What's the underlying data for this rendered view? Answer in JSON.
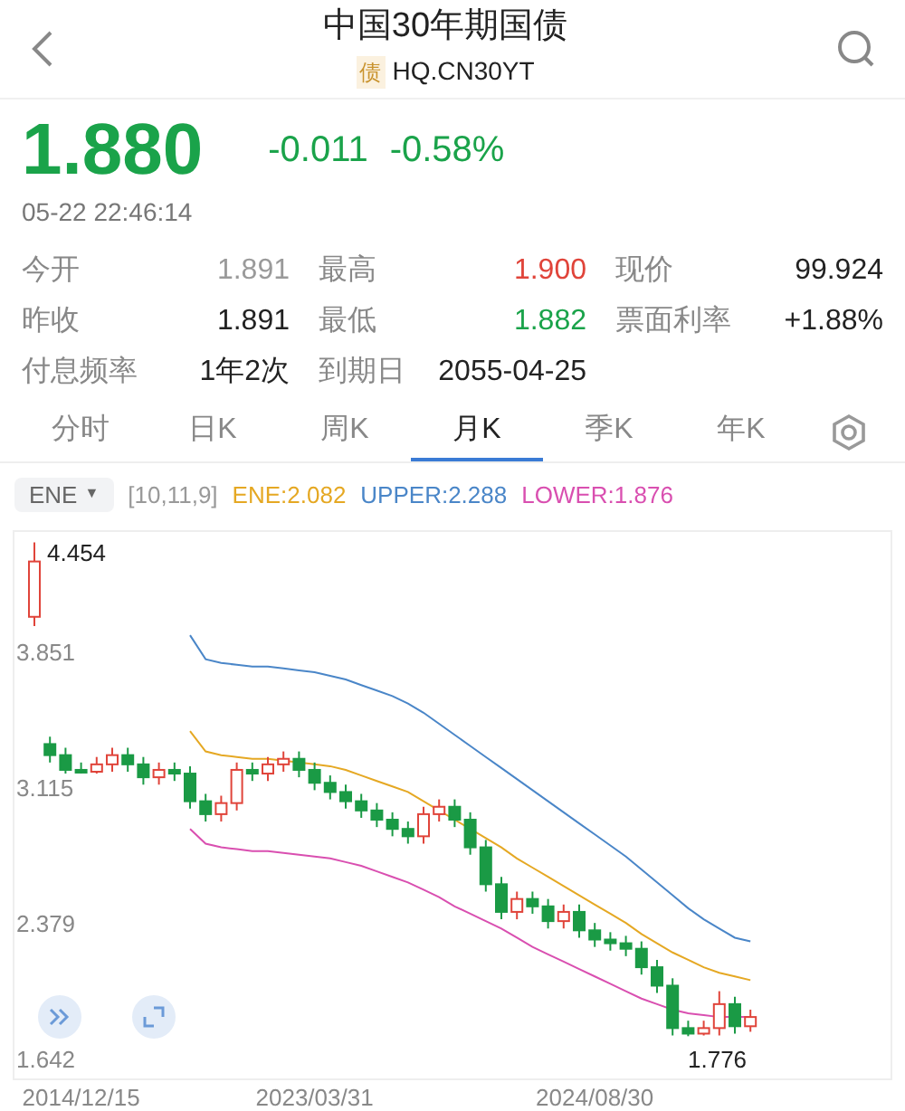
{
  "header": {
    "title": "中国30年期国债",
    "badge": "债",
    "code": "HQ.CN30YT"
  },
  "quote": {
    "price": "1.880",
    "change": "-0.011",
    "change_pct": "-0.58%",
    "color": "#1aa34a",
    "time": "05-22 22:46:14"
  },
  "stats": [
    {
      "label": "今开",
      "value": "1.891",
      "color": "#9a9a9a"
    },
    {
      "label": "最高",
      "value": "1.900",
      "color": "#e0443a"
    },
    {
      "label": "现价",
      "value": "99.924",
      "color": "#222222"
    },
    {
      "label": "昨收",
      "value": "1.891",
      "color": "#222222"
    },
    {
      "label": "最低",
      "value": "1.882",
      "color": "#1aa34a"
    },
    {
      "label": "票面利率",
      "value": "+1.88%",
      "color": "#222222"
    },
    {
      "label": "付息频率",
      "value": "1年2次",
      "color": "#222222"
    },
    {
      "label": "到期日",
      "value": "2055-04-25",
      "color": "#222222"
    }
  ],
  "tabs": [
    {
      "label": "分时",
      "selected": false
    },
    {
      "label": "日K",
      "selected": false
    },
    {
      "label": "周K",
      "selected": false
    },
    {
      "label": "月K",
      "selected": true
    },
    {
      "label": "季K",
      "selected": false
    },
    {
      "label": "年K",
      "selected": false
    }
  ],
  "indicator": {
    "selector": "ENE",
    "caret": "▼",
    "params": "[10,11,9]"
  },
  "chart": {
    "max_marker": "4.454",
    "min_marker": "1.776",
    "chart_data": {
      "type": "candlestick",
      "categories": [
        null,
        null,
        null,
        "2014/12/15",
        null,
        null,
        null,
        null,
        null,
        null,
        null,
        null,
        null,
        null,
        null,
        null,
        null,
        null,
        "2023/03/31",
        null,
        null,
        null,
        null,
        null,
        null,
        null,
        null,
        null,
        null,
        null,
        null,
        null,
        null,
        null,
        null,
        null,
        "2024/08/30",
        null,
        null,
        null,
        null,
        null,
        null,
        null,
        null,
        null,
        null
      ],
      "ylim": [
        1.547,
        4.51
      ],
      "yticks": [
        {
          "value": 3.851,
          "label": "3.851"
        },
        {
          "value": 3.115,
          "label": "3.115"
        },
        {
          "value": 2.379,
          "label": "2.379"
        },
        {
          "value": 1.642,
          "label": "1.642"
        }
      ],
      "ohlc": [
        [
          4.05,
          4.454,
          4.0,
          4.35
        ],
        [
          3.36,
          3.4,
          3.26,
          3.3
        ],
        [
          3.3,
          3.34,
          3.2,
          3.22
        ],
        [
          3.22,
          3.26,
          3.2,
          3.21
        ],
        [
          3.21,
          3.29,
          3.2,
          3.25
        ],
        [
          3.25,
          3.34,
          3.21,
          3.3
        ],
        [
          3.3,
          3.34,
          3.21,
          3.25
        ],
        [
          3.25,
          3.29,
          3.14,
          3.18
        ],
        [
          3.18,
          3.26,
          3.14,
          3.22
        ],
        [
          3.22,
          3.26,
          3.16,
          3.2
        ],
        [
          3.2,
          3.24,
          3.01,
          3.05
        ],
        [
          3.05,
          3.09,
          2.94,
          2.98
        ],
        [
          2.98,
          3.08,
          2.94,
          3.04
        ],
        [
          3.04,
          3.26,
          3.0,
          3.22
        ],
        [
          3.22,
          3.26,
          3.16,
          3.2
        ],
        [
          3.2,
          3.29,
          3.16,
          3.25
        ],
        [
          3.25,
          3.32,
          3.21,
          3.28
        ],
        [
          3.28,
          3.32,
          3.18,
          3.22
        ],
        [
          3.22,
          3.26,
          3.11,
          3.15
        ],
        [
          3.15,
          3.19,
          3.06,
          3.1
        ],
        [
          3.1,
          3.14,
          3.01,
          3.05
        ],
        [
          3.05,
          3.09,
          2.96,
          3.0
        ],
        [
          3.0,
          3.04,
          2.91,
          2.95
        ],
        [
          2.95,
          2.99,
          2.86,
          2.9
        ],
        [
          2.9,
          2.94,
          2.82,
          2.86
        ],
        [
          2.86,
          3.02,
          2.82,
          2.98
        ],
        [
          2.98,
          3.06,
          2.94,
          3.02
        ],
        [
          3.02,
          3.06,
          2.91,
          2.95
        ],
        [
          2.95,
          2.99,
          2.76,
          2.8
        ],
        [
          2.8,
          2.84,
          2.56,
          2.6
        ],
        [
          2.6,
          2.64,
          2.41,
          2.45
        ],
        [
          2.45,
          2.56,
          2.41,
          2.52
        ],
        [
          2.52,
          2.56,
          2.44,
          2.48
        ],
        [
          2.48,
          2.52,
          2.36,
          2.4
        ],
        [
          2.4,
          2.49,
          2.36,
          2.45
        ],
        [
          2.45,
          2.49,
          2.31,
          2.35
        ],
        [
          2.35,
          2.39,
          2.26,
          2.3
        ],
        [
          2.3,
          2.34,
          2.24,
          2.28
        ],
        [
          2.28,
          2.32,
          2.21,
          2.25
        ],
        [
          2.25,
          2.29,
          2.11,
          2.15
        ],
        [
          2.15,
          2.19,
          2.01,
          2.05
        ],
        [
          2.05,
          2.09,
          1.78,
          1.82
        ],
        [
          1.82,
          1.86,
          1.776,
          1.79
        ],
        [
          1.79,
          1.86,
          1.78,
          1.82
        ],
        [
          1.82,
          2.02,
          1.78,
          1.95
        ],
        [
          1.95,
          1.99,
          1.79,
          1.83
        ],
        [
          1.83,
          1.92,
          1.8,
          1.88
        ]
      ],
      "series": [
        {
          "name": "ENE:2.082",
          "type": "line",
          "color": "#e5a823",
          "values": [
            null,
            null,
            null,
            null,
            null,
            null,
            null,
            null,
            null,
            null,
            3.43,
            3.32,
            3.3,
            3.29,
            3.28,
            3.28,
            3.27,
            3.26,
            3.25,
            3.24,
            3.22,
            3.19,
            3.16,
            3.13,
            3.1,
            3.05,
            3.0,
            2.95,
            2.9,
            2.85,
            2.8,
            2.74,
            2.69,
            2.64,
            2.59,
            2.54,
            2.49,
            2.44,
            2.39,
            2.33,
            2.28,
            2.23,
            2.19,
            2.15,
            2.12,
            2.1,
            2.08
          ]
        },
        {
          "name": "UPPER:2.288",
          "type": "line",
          "color": "#4a86c8",
          "values": [
            null,
            null,
            null,
            null,
            null,
            null,
            null,
            null,
            null,
            null,
            3.95,
            3.82,
            3.8,
            3.79,
            3.78,
            3.78,
            3.77,
            3.76,
            3.75,
            3.73,
            3.71,
            3.68,
            3.65,
            3.62,
            3.58,
            3.53,
            3.47,
            3.41,
            3.35,
            3.29,
            3.23,
            3.17,
            3.11,
            3.05,
            2.99,
            2.93,
            2.87,
            2.81,
            2.75,
            2.68,
            2.61,
            2.54,
            2.47,
            2.41,
            2.36,
            2.31,
            2.29
          ]
        },
        {
          "name": "LOWER:1.876",
          "type": "line",
          "color": "#d94fb0",
          "values": [
            null,
            null,
            null,
            null,
            null,
            null,
            null,
            null,
            null,
            null,
            2.9,
            2.82,
            2.8,
            2.79,
            2.78,
            2.78,
            2.77,
            2.76,
            2.75,
            2.74,
            2.72,
            2.7,
            2.67,
            2.64,
            2.61,
            2.57,
            2.53,
            2.48,
            2.44,
            2.4,
            2.36,
            2.31,
            2.26,
            2.22,
            2.18,
            2.14,
            2.1,
            2.06,
            2.02,
            1.98,
            1.95,
            1.92,
            1.9,
            1.89,
            1.88,
            1.88,
            1.88
          ]
        }
      ]
    }
  }
}
